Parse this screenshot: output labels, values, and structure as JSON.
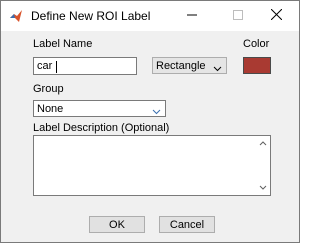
{
  "window": {
    "title": "Define New ROI Label",
    "icon": "matlab-icon",
    "controls": {
      "minimize": "minimize-icon",
      "maximize": "maximize-icon",
      "close": "close-icon"
    }
  },
  "form": {
    "label_name_caption": "Label Name",
    "label_name_value": "car",
    "shape_value": "Rectangle",
    "color_caption": "Color",
    "color_value": "#a93a32",
    "group_caption": "Group",
    "group_value": "None",
    "description_caption": "Label Description (Optional)",
    "description_value": ""
  },
  "buttons": {
    "ok": "OK",
    "cancel": "Cancel"
  }
}
